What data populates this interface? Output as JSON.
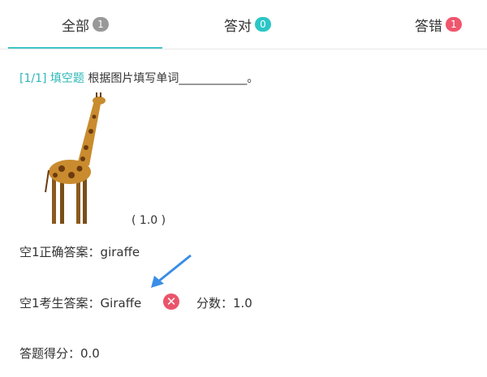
{
  "tabs": [
    {
      "label": "全部",
      "count": "1",
      "badge_color": "#999999"
    },
    {
      "label": "答对",
      "count": "0",
      "badge_color": "#2cc6c6"
    },
    {
      "label": "答错",
      "count": "1",
      "badge_color": "#f0566e"
    }
  ],
  "question": {
    "number": "[1/1]",
    "type": "填空题",
    "prompt": "根据图片填写单词____________。",
    "score_paren": "( 1.0 )"
  },
  "answers": {
    "correct": "空1正确答案：giraffe",
    "student": "空1考生答案：Giraffe",
    "score": "分数：1.0",
    "total": "答题得分：0.0"
  },
  "icons": {
    "result": "wrong-icon",
    "arrow": "arrow-icon"
  },
  "colors": {
    "accent": "#3ec6c6",
    "wrong": "#e9546b",
    "arrow": "#3a8ee6"
  }
}
